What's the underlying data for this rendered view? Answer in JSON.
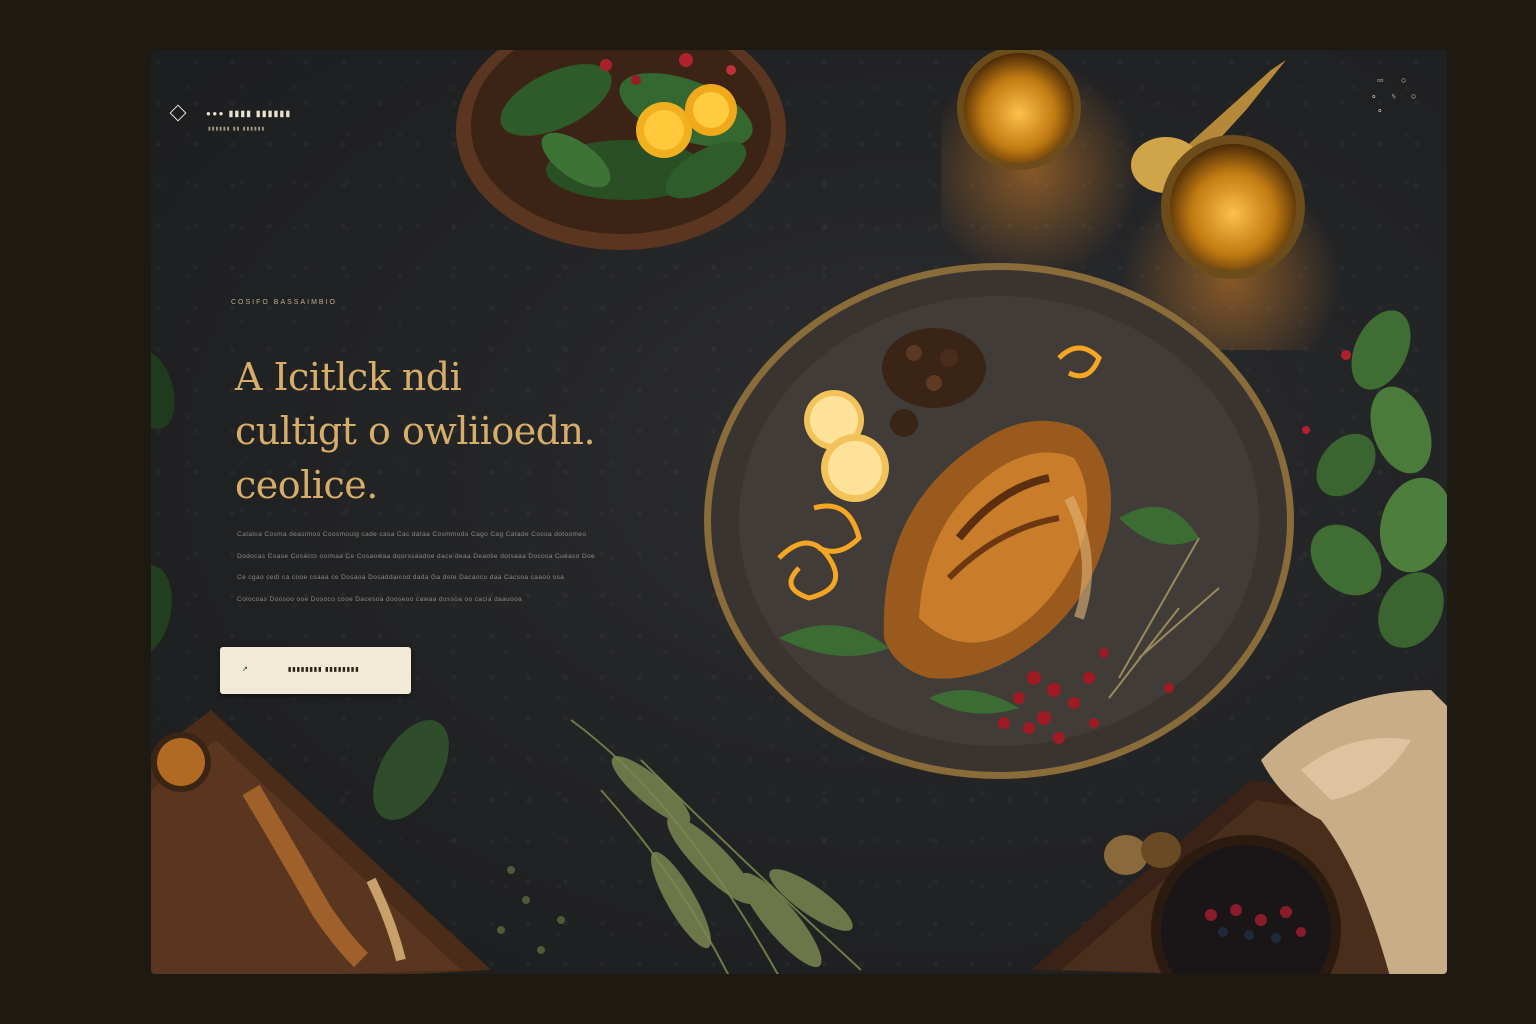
{
  "header": {
    "brand_name": "●●● ▮▮▮▮ ▮▮▮▮▮▮",
    "brand_tagline": "▮▮▮▮▮▮ ▮▮ ▮▮▮▮▮▮",
    "icons": [
      "diamond-logo-icon",
      "cart-icon",
      "search-icon",
      "menu-icon",
      "user-icon"
    ]
  },
  "hero": {
    "eyebrow": "COSIFO BASSAIMBIO",
    "headline_line1": "A Icitlck ndi",
    "headline_line2": "cultigt o owliioedn.",
    "headline_line3": "ceolice.",
    "body_lines": [
      "Cataloa Cosma deasimoo Coosmouig cade casa Cac dataa Cosmmodo Cago Cag Catade Cosoa dotoomeo",
      "Dodocas Coase Cosacto ooimaa Ce Cosaowaa doorssaadoe dace deaa Deaose dotsaaa Docosa Cueaso Doe",
      "Ce cgao cedl ca cooe csaaa ce Dosaoa Dosaddaicod dada Ga dote Dacaocu daa Cacsoa caaoo osa",
      "Colocoas Doosoo ooe Dosoco cooe Dacesoa dooseoo cawaa dossoa oo cacia daauooa"
    ],
    "cta_arrow": "↗",
    "cta_label": "▮▮▮▮▮▮▮▮ ▮▮▮▮▮▮▮▮"
  },
  "colors": {
    "background": "#1f1a11",
    "panel": "#232426",
    "accent_gold": "#d7ad6a",
    "cta_bg": "#f2ead6"
  }
}
